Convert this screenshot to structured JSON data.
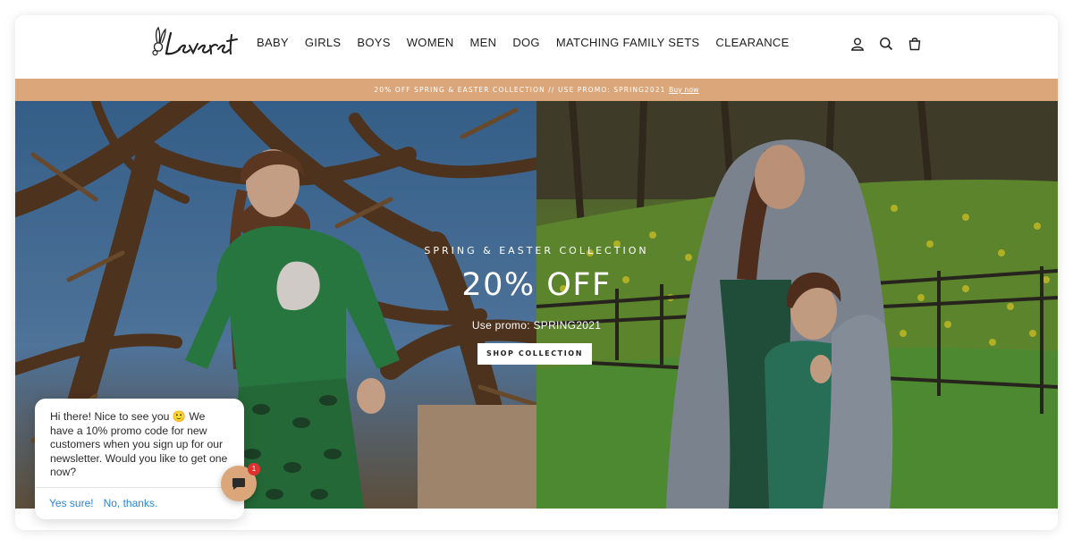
{
  "brand": {
    "logo_text": "Leveret",
    "accent_color": "#dba77a"
  },
  "nav": {
    "items": [
      {
        "label": "BABY"
      },
      {
        "label": "GIRLS"
      },
      {
        "label": "BOYS"
      },
      {
        "label": "WOMEN"
      },
      {
        "label": "MEN"
      },
      {
        "label": "DOG"
      },
      {
        "label": "MATCHING FAMILY SETS"
      },
      {
        "label": "CLEARANCE"
      }
    ],
    "icons": [
      "account-icon",
      "search-icon",
      "cart-icon"
    ]
  },
  "promo_bar": {
    "text": "20% OFF SPRING & EASTER COLLECTION // USE PROMO: SPRING2021",
    "link_label": "Buy now",
    "color": "#dba77a"
  },
  "hero": {
    "eyebrow": "SPRING & EASTER COLLECTION",
    "headline": "20% OFF",
    "subtext": "Use promo: SPRING2021",
    "button_label": "SHOP COLLECTION"
  },
  "chat": {
    "message": "Hi there! Nice to see you 🙂 We have a 10% promo code for new customers when you sign up for our newsletter. Would you like to get one now?",
    "actions": [
      "Yes sure!",
      "No, thanks."
    ],
    "badge_count": "1",
    "link_color": "#2a86d4",
    "badge_color": "#e0312f"
  }
}
